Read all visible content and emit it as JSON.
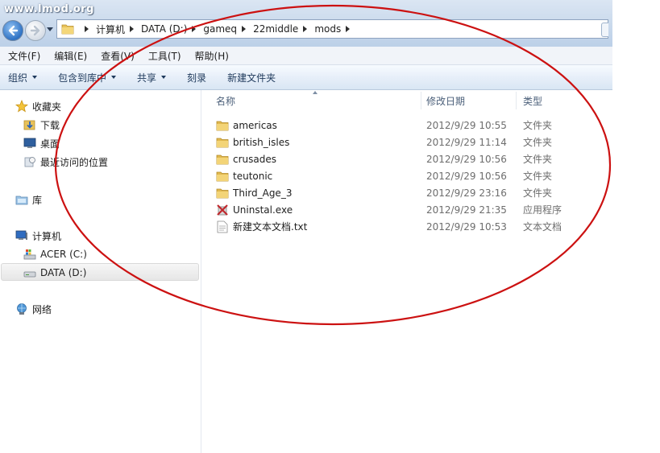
{
  "watermark": "www.lmod.org",
  "address_bar": {
    "crumbs": [
      "计算机",
      "DATA (D:)",
      "gameq",
      "22middle",
      "mods"
    ]
  },
  "menu": [
    "文件(F)",
    "编辑(E)",
    "查看(V)",
    "工具(T)",
    "帮助(H)"
  ],
  "toolbar": {
    "organize": "组织",
    "include_in_library": "包含到库中",
    "share": "共享",
    "burn": "刻录",
    "new_folder": "新建文件夹"
  },
  "nav": {
    "favorites": "收藏夹",
    "downloads": "下载",
    "desktop": "桌面",
    "recent": "最近访问的位置",
    "libraries": "库",
    "computer": "计算机",
    "drive_c": "ACER (C:)",
    "drive_d": "DATA (D:)",
    "network": "网络"
  },
  "columns": {
    "name": "名称",
    "date": "修改日期",
    "type": "类型"
  },
  "files": [
    {
      "name": "americas",
      "date": "2012/9/29 10:55",
      "type": "文件夹",
      "icon": "folder-icon"
    },
    {
      "name": "british_isles",
      "date": "2012/9/29 11:14",
      "type": "文件夹",
      "icon": "folder-icon"
    },
    {
      "name": "crusades",
      "date": "2012/9/29 10:56",
      "type": "文件夹",
      "icon": "folder-icon"
    },
    {
      "name": "teutonic",
      "date": "2012/9/29 10:56",
      "type": "文件夹",
      "icon": "folder-icon"
    },
    {
      "name": "Third_Age_3",
      "date": "2012/9/29 23:16",
      "type": "文件夹",
      "icon": "folder-icon"
    },
    {
      "name": "Uninstal.exe",
      "date": "2012/9/29 21:35",
      "type": "应用程序",
      "icon": "uninstaller-icon"
    },
    {
      "name": "新建文本文档.txt",
      "date": "2012/9/29 10:53",
      "type": "文本文档",
      "icon": "text-file-icon"
    }
  ],
  "colors": {
    "accent": "#1e395b",
    "annotation": "#cc1111",
    "selection": "#e6e6e6"
  }
}
